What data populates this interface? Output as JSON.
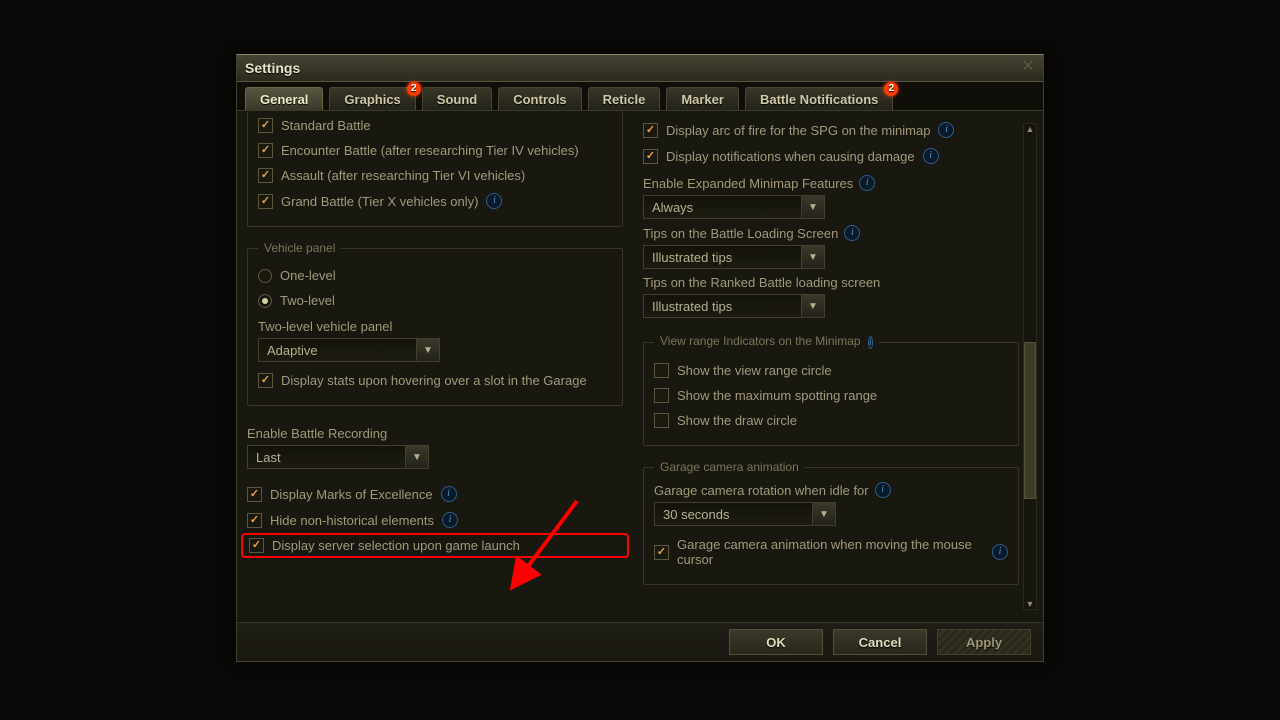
{
  "window": {
    "title": "Settings"
  },
  "tabs": [
    {
      "label": "General",
      "active": true,
      "badge": null
    },
    {
      "label": "Graphics",
      "active": false,
      "badge": "2"
    },
    {
      "label": "Sound",
      "active": false,
      "badge": null
    },
    {
      "label": "Controls",
      "active": false,
      "badge": null
    },
    {
      "label": "Reticle",
      "active": false,
      "badge": null
    },
    {
      "label": "Marker",
      "active": false,
      "badge": null
    },
    {
      "label": "Battle Notifications",
      "active": false,
      "badge": "2"
    }
  ],
  "left": {
    "battle_types": {
      "standard": "Standard Battle",
      "encounter": "Encounter Battle (after researching Tier IV vehicles)",
      "assault": "Assault (after researching Tier VI vehicles)",
      "grand": "Grand Battle (Tier X vehicles only)"
    },
    "vehicle_panel": {
      "legend": "Vehicle panel",
      "one_level": "One-level",
      "two_level": "Two-level",
      "two_level_label": "Two-level vehicle panel",
      "two_level_value": "Adaptive",
      "hover_stats": "Display stats upon hovering over a slot in the Garage"
    },
    "recording": {
      "label": "Enable Battle Recording",
      "value": "Last"
    },
    "marks": "Display Marks of Excellence",
    "nonhist": "Hide non-historical elements",
    "serversel": "Display server selection upon game launch"
  },
  "right": {
    "arc": "Display arc of fire for the SPG on the minimap",
    "dmg": "Display notifications when causing damage",
    "exp_mm": {
      "label": "Enable Expanded Minimap Features",
      "value": "Always"
    },
    "tips_load": {
      "label": "Tips on the Battle Loading Screen",
      "value": "Illustrated tips"
    },
    "tips_rank": {
      "label": "Tips on the Ranked Battle loading screen",
      "value": "Illustrated tips"
    },
    "view_range": {
      "legend": "View range Indicators on the Minimap",
      "circle": "Show the view range circle",
      "maxspot": "Show the maximum spotting range",
      "draw": "Show the draw circle"
    },
    "garage": {
      "legend": "Garage camera animation",
      "idle_label": "Garage camera rotation when idle for",
      "idle_value": "30 seconds",
      "mouse": "Garage camera animation when moving the mouse cursor"
    }
  },
  "footer": {
    "ok": "OK",
    "cancel": "Cancel",
    "apply": "Apply"
  }
}
